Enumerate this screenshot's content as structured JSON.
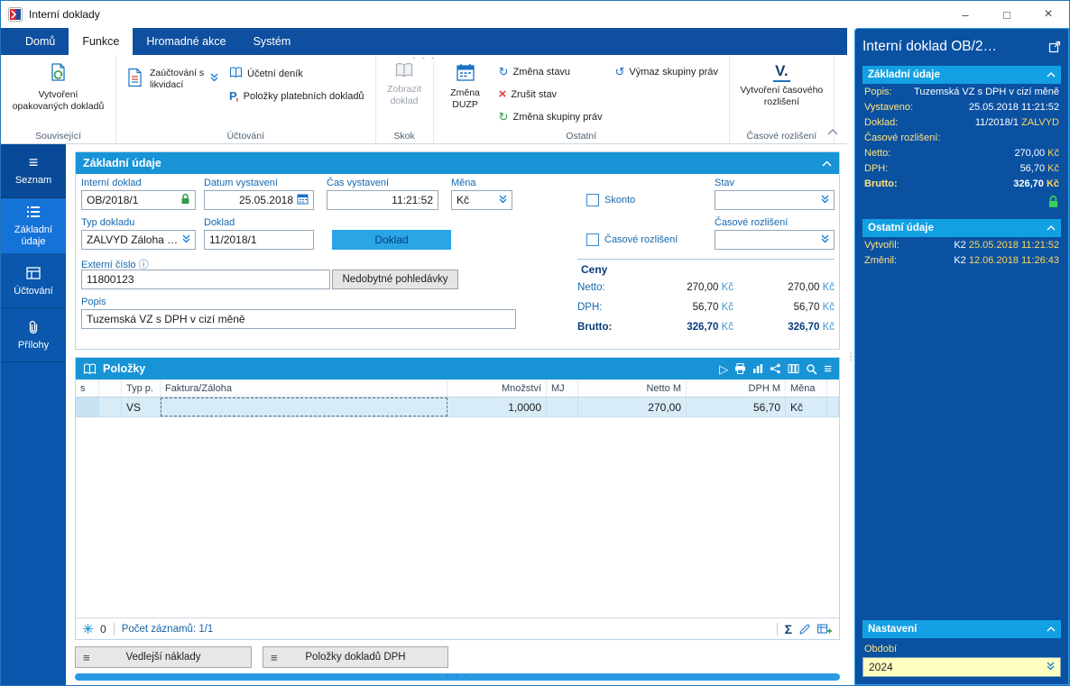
{
  "window": {
    "title": "Interní doklady",
    "controls": {
      "minimize": "–",
      "maximize": "□",
      "close": "×"
    }
  },
  "tabs": {
    "domu": "Domů",
    "funkce": "Funkce",
    "hromadne": "Hromadné akce",
    "system": "Systém"
  },
  "ribbon": {
    "vytvoreni_opak": "Vytvoření opakovaných dokladů",
    "zauctovani": "Zaúčtování s likvidací",
    "ucetni_denik": "Účetní deník",
    "polozky_plat": "Položky platebních dokladů",
    "zobrazit": "Zobrazit doklad",
    "zmena_duzp": "Změna DUZP",
    "zmena_stavu": "Změna stavu",
    "zrusit_stav": "Zrušit stav",
    "zmena_skupiny": "Změna skupiny práv",
    "vymaz_skupiny": "Výmaz skupiny práv",
    "vytvoreni_cas": "Vytvoření časového rozlišení",
    "v_icon": "V.",
    "groups": {
      "souvisejici": "Související",
      "uctovani": "Účtování",
      "skok": "Skok",
      "ostatni": "Ostatní",
      "casove": "Časové rozlišení"
    }
  },
  "sidebar": {
    "seznam": "Seznam",
    "zakladni": "Základní údaje",
    "uctovani": "Účtování",
    "prilohy": "Přílohy"
  },
  "form": {
    "header": "Základní údaje",
    "interni_label": "Interní doklad",
    "interni": "OB/2018/1",
    "datum_label": "Datum vystavení",
    "datum": "25.05.2018",
    "cas_label": "Čas vystavení",
    "cas": "11:21:52",
    "mena_label": "Měna",
    "mena": "Kč",
    "skonto_label": "Skonto",
    "stav_label": "Stav",
    "typ_label": "Typ dokladu",
    "typ": "ZALVYD Záloha p...",
    "doklad_label": "Doklad",
    "doklad": "11/2018/1",
    "doklad_btn": "Doklad",
    "casove_check_label": "Časové rozlišení",
    "casove_label": "Časové rozlišení",
    "externi_label": "Externí číslo",
    "externi": "11800123",
    "nedobytne_btn": "Nedobytné pohledávky",
    "popis_label": "Popis",
    "popis": "Tuzemská VZ s DPH v cizí měně",
    "ceny": {
      "title": "Ceny",
      "rows": [
        {
          "label": "Netto:",
          "v1": "270,00",
          "v2": "270,00",
          "cur": "Kč"
        },
        {
          "label": "DPH:",
          "v1": "56,70",
          "v2": "56,70",
          "cur": "Kč"
        },
        {
          "label": "Brutto:",
          "v1": "326,70",
          "v2": "326,70",
          "cur": "Kč"
        }
      ]
    }
  },
  "grid": {
    "header": "Položky",
    "columns": {
      "c_s": "s",
      "c_b": "",
      "c_typ": "Typ p.",
      "c_fak": "Faktura/Záloha",
      "c_mn": "Množství",
      "c_mj": "MJ",
      "c_net": "Netto M",
      "c_dph": "DPH M",
      "c_men": "Měna"
    },
    "row": {
      "typ": "VS",
      "mnozstvi": "1,0000",
      "netto": "270,00",
      "dph": "56,70",
      "mena": "Kč"
    },
    "footer": {
      "count": "0",
      "records": "Počet záznamů: 1/1"
    }
  },
  "bottom": {
    "vedlejsi": "Vedlejší náklady",
    "polozky_dph": "Položky dokladů DPH"
  },
  "panel": {
    "title": "Interní doklad OB/2…",
    "zakladni": {
      "header": "Základní údaje",
      "rows": {
        "popis_l": "Popis:",
        "popis": "Tuzemská VZ s DPH v cizí měně",
        "vyst_l": "Vystaveno:",
        "vyst": "25.05.2018 11:21:52",
        "dokl_l": "Doklad:",
        "dokl": "11/2018/1",
        "dokl_typ": "ZALVYD",
        "cas_l": "Časové rozlišení:",
        "netto_l": "Netto:",
        "netto": "270,00",
        "dph_l": "DPH:",
        "dph": "56,70",
        "brutto_l": "Brutto:",
        "brutto": "326,70",
        "cur": "Kč"
      }
    },
    "ostatni": {
      "header": "Ostatní údaje",
      "rows": {
        "vytvoril_l": "Vytvořil:",
        "vytvoril_u": "K2",
        "vytvoril_t": "25.05.2018 11:21:52",
        "zmenil_l": "Změnil:",
        "zmenil_u": "K2",
        "zmenil_t": "12.06.2018 11:26:43"
      }
    },
    "nastaveni": {
      "header": "Nastavení",
      "obdobi_l": "Období",
      "obdobi": "2024"
    }
  },
  "icons": {
    "hamburger": "≡",
    "play": "▷",
    "sigma": "Σ",
    "refresh": "↻",
    "rotate": "↺",
    "cancel": "×",
    "info": "ⓘ",
    "vdots": "⋮",
    "hdots": "· · ·"
  }
}
